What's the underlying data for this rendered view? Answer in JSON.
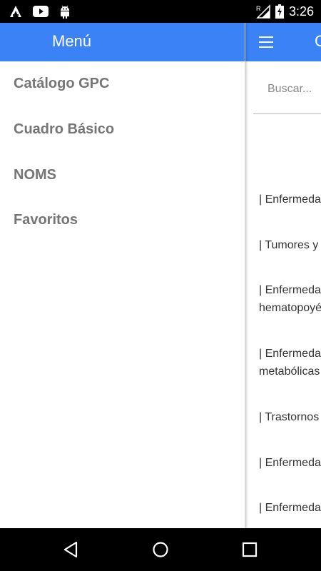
{
  "status_bar": {
    "time": "3:26",
    "signal_label": "R",
    "left_icons": [
      "app-a-icon",
      "youtube-icon",
      "android-icon"
    ]
  },
  "main": {
    "title_fragment": "C",
    "search": {
      "placeholder": "Buscar...",
      "value": ""
    },
    "items": [
      "| Enfermedades",
      "| Tumores y",
      "| Enfermedades",
      "hematopoyéticos",
      "| Enfermedades",
      "metabólicas",
      "| Trastornos",
      "| Enfermedades",
      "| Enfermedades"
    ]
  },
  "drawer": {
    "title": "Menú",
    "items": [
      {
        "label": "Catálogo GPC"
      },
      {
        "label": "Cuadro Básico"
      },
      {
        "label": "NOMS"
      },
      {
        "label": "Favoritos"
      }
    ]
  },
  "colors": {
    "primary": "#3b82f6",
    "menu_text": "#757575",
    "status_bar": "#000000"
  }
}
